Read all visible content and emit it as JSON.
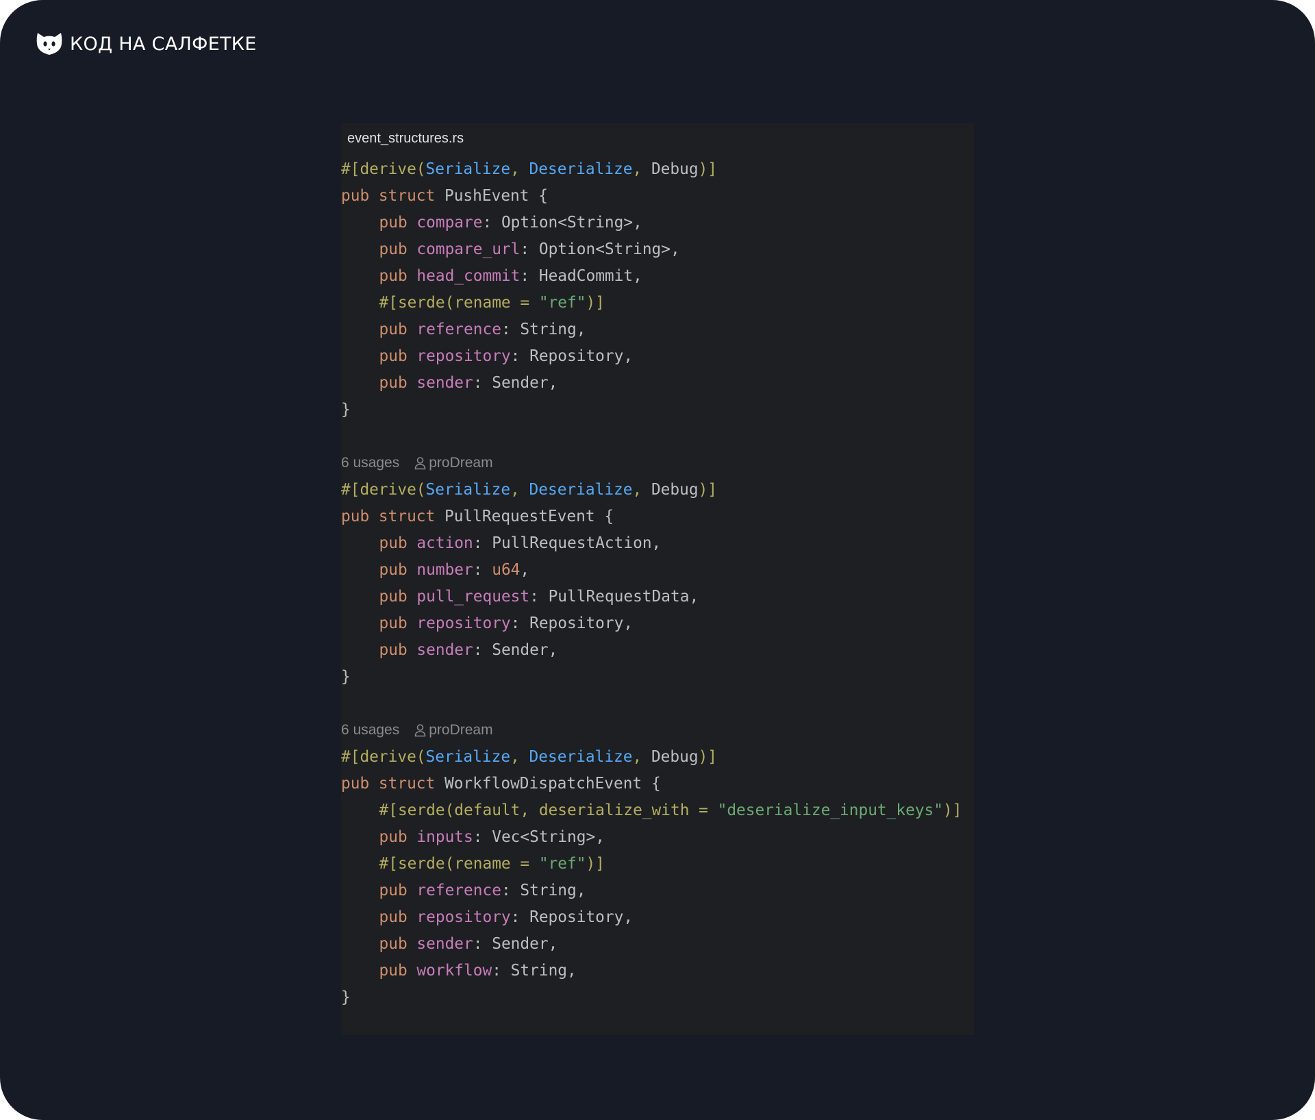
{
  "brand": {
    "title": "КОД НА САЛФЕТКЕ",
    "icon": "cat-logo-icon"
  },
  "editor": {
    "filename": "event_structures.rs",
    "colors": {
      "keyword": "#cf8e6d",
      "field": "#c77dbb",
      "annotation": "#b3ae60",
      "class": "#56a8f5",
      "string": "#6aab73",
      "text": "#bcbec4",
      "background": "#1e1f22"
    },
    "tok": {
      "derive_prefix": "#[derive(",
      "serialize": "Serialize",
      "comma": ", ",
      "deserialize": "Deserialize",
      "debug": "Debug",
      "close_attr": ")]",
      "pub": "pub ",
      "struct": "struct ",
      "brace_open": " {",
      "brace_close": "}",
      "colon": ": ",
      "comma_end": ",",
      "serde_rename_prefix": "#[serde(rename = ",
      "ref_str": "\"ref\"",
      "serde_default_prefix": "#[serde(default, deserialize_with = ",
      "input_keys_str": "\"deserialize_input_keys\""
    },
    "structs": [
      {
        "name": "PushEvent",
        "fields": [
          {
            "name": "compare",
            "type": "Option<String>"
          },
          {
            "name": "compare_url",
            "type": "Option<String>"
          },
          {
            "name": "head_commit",
            "type": "HeadCommit"
          },
          {
            "name": "reference",
            "type": "String"
          },
          {
            "name": "repository",
            "type": "Repository"
          },
          {
            "name": "sender",
            "type": "Sender"
          }
        ]
      },
      {
        "usages": "6 usages",
        "author": "proDream",
        "name": "PullRequestEvent",
        "fields": [
          {
            "name": "action",
            "type": "PullRequestAction"
          },
          {
            "name": "number",
            "type": "u64"
          },
          {
            "name": "pull_request",
            "type": "PullRequestData"
          },
          {
            "name": "repository",
            "type": "Repository"
          },
          {
            "name": "sender",
            "type": "Sender"
          }
        ]
      },
      {
        "usages": "6 usages",
        "author": "proDream",
        "name": "WorkflowDispatchEvent",
        "fields": [
          {
            "name": "inputs",
            "type": "Vec<String>"
          },
          {
            "name": "reference",
            "type": "String"
          },
          {
            "name": "repository",
            "type": "Repository"
          },
          {
            "name": "sender",
            "type": "Sender"
          },
          {
            "name": "workflow",
            "type": "String"
          }
        ]
      }
    ]
  }
}
